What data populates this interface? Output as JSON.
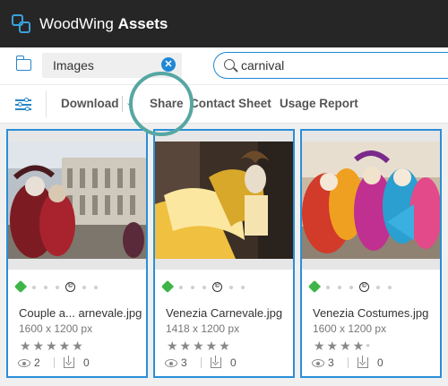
{
  "header": {
    "brand_prefix": "WoodWing",
    "brand_suffix": "Assets"
  },
  "search": {
    "folder_chip": "Images",
    "query": "carnival"
  },
  "toolbar": {
    "download": "Download",
    "share": "Share",
    "contact_sheet": "Contact Sheet",
    "usage_report": "Usage Report"
  },
  "assets": [
    {
      "filename": "Couple a... arnevale.jpg",
      "dimensions": "1600 x 1200 px",
      "rating": 5,
      "views": "2",
      "downloads": "0"
    },
    {
      "filename": "Venezia Carnevale.jpg",
      "dimensions": "1418 x 1200 px",
      "rating": 5,
      "views": "3",
      "downloads": "0"
    },
    {
      "filename": "Venezia Costumes.jpg",
      "dimensions": "1600 x 1200 px",
      "rating": 4,
      "views": "3",
      "downloads": "0"
    }
  ],
  "colors": {
    "accent": "#1f88d6",
    "highlight_ring": "#56a7a2",
    "tag": "#3fb549",
    "header_bg": "#262626"
  }
}
